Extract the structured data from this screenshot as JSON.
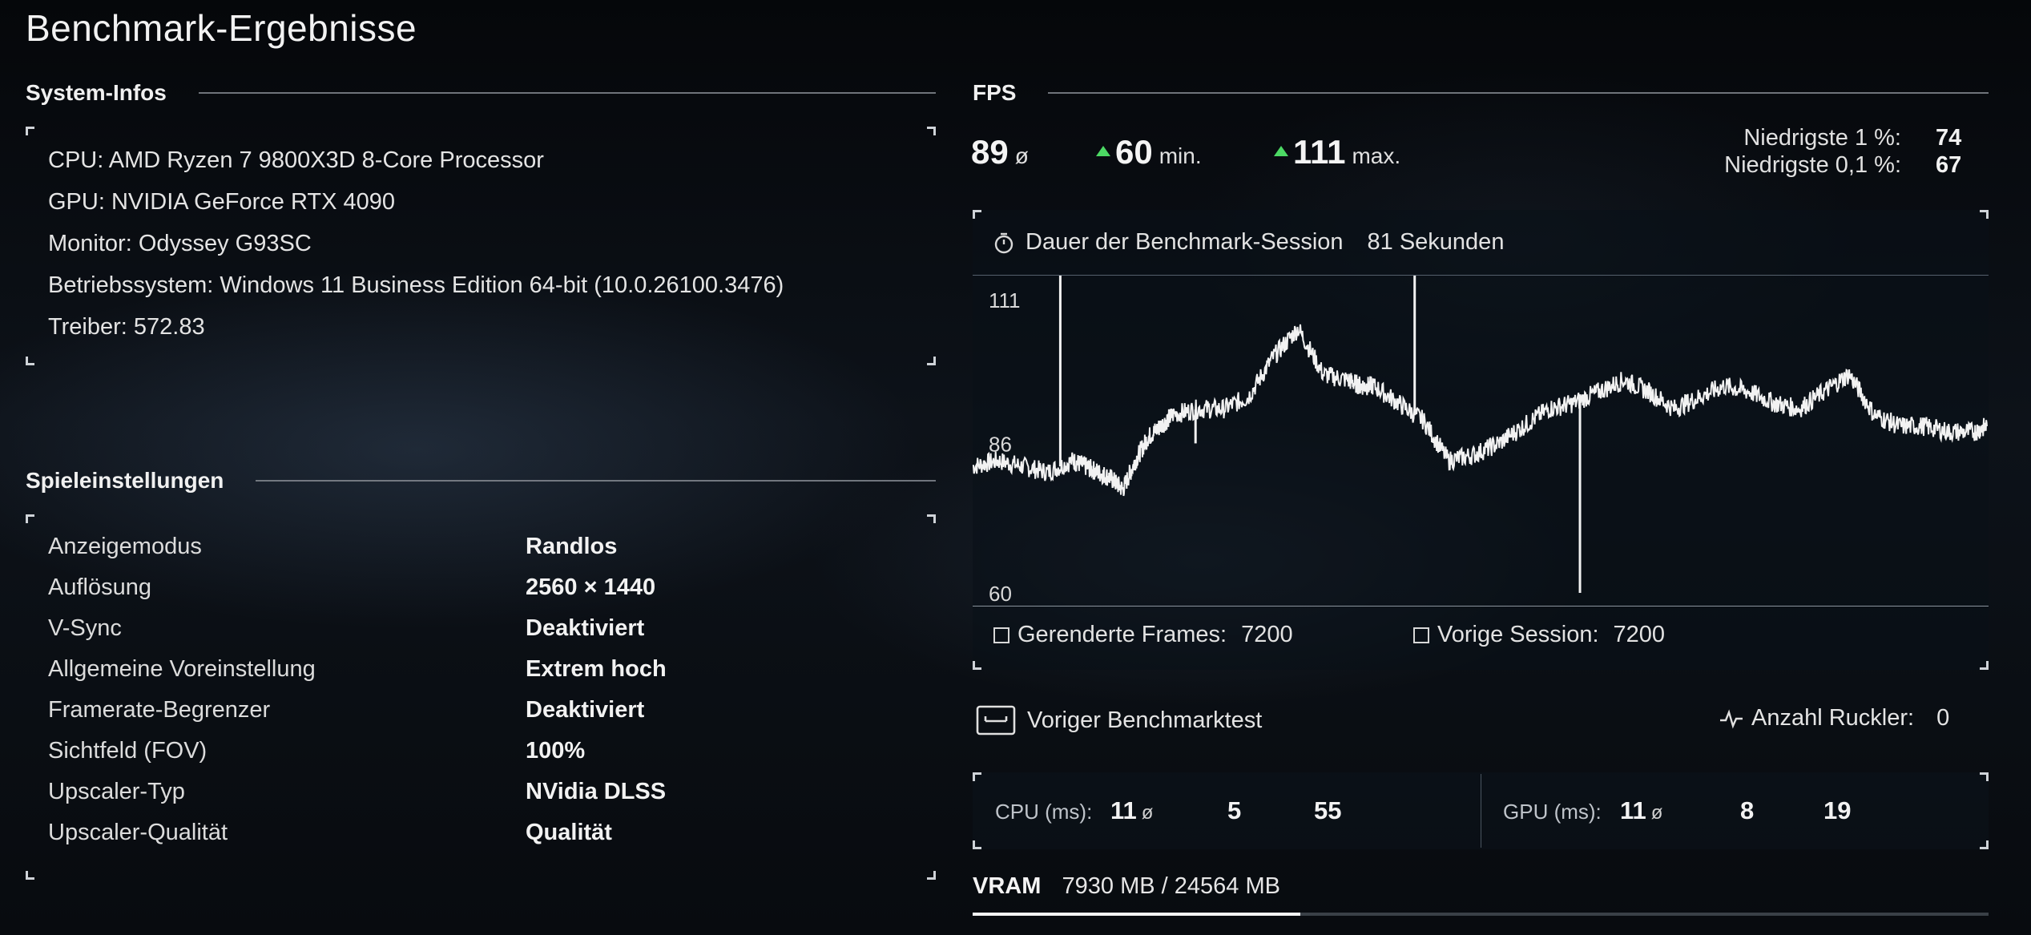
{
  "title": "Benchmark-Ergebnisse",
  "system_info": {
    "heading": "System-Infos",
    "lines": [
      "CPU: AMD Ryzen 7 9800X3D 8-Core Processor",
      "GPU: NVIDIA GeForce RTX 4090",
      "Monitor: Odyssey G93SC",
      "Betriebssystem: Windows 11 Business Edition 64-bit (10.0.26100.3476)",
      "Treiber: 572.83"
    ]
  },
  "game_settings": {
    "heading": "Spieleinstellungen",
    "rows": [
      {
        "label": "Anzeigemodus",
        "value": "Randlos"
      },
      {
        "label": "Auflösung",
        "value": "2560 × 1440"
      },
      {
        "label": "V-Sync",
        "value": "Deaktiviert"
      },
      {
        "label": "Allgemeine Voreinstellung",
        "value": "Extrem hoch"
      },
      {
        "label": "Framerate-Begrenzer",
        "value": "Deaktiviert"
      },
      {
        "label": "Sichtfeld (FOV)",
        "value": "100%"
      },
      {
        "label": "Upscaler-Typ",
        "value": "NVidia DLSS"
      },
      {
        "label": "Upscaler-Qualität",
        "value": "Qualität"
      }
    ]
  },
  "fps": {
    "heading": "FPS",
    "avg": "89",
    "avg_unit": "ø",
    "min": "60",
    "min_unit": "min.",
    "max": "111",
    "max_unit": "max.",
    "low1_label": "Niedrigste 1 %:",
    "low1_value": "74",
    "low01_label": "Niedrigste 0,1 %:",
    "low01_value": "67",
    "indicator_color": "#4cd964"
  },
  "session": {
    "icon": "stopwatch-icon",
    "label": "Dauer der Benchmark-Session",
    "value": "81 Sekunden"
  },
  "chart_data": {
    "type": "line",
    "title": "",
    "xlabel": "",
    "ylabel": "",
    "ylim": [
      60,
      111
    ],
    "yticks": [
      "111",
      "86",
      "60"
    ],
    "x": [
      0,
      2,
      4,
      6,
      8,
      9,
      10,
      11,
      12,
      13,
      14,
      15,
      16,
      18,
      20,
      22,
      24,
      26,
      28,
      30,
      31,
      32,
      34,
      36,
      38,
      40,
      42,
      44,
      46,
      48,
      50,
      52,
      54,
      56,
      58,
      60,
      62,
      64,
      66,
      68,
      70,
      72,
      74,
      76,
      78,
      80,
      81
    ],
    "series": [
      {
        "values": [
          82,
          83,
          82,
          81,
          83,
          82,
          81,
          80,
          78,
          83,
          87,
          89,
          91,
          92,
          92,
          94,
          101,
          106,
          98,
          97,
          96,
          96,
          93,
          90,
          83,
          84,
          86,
          89,
          92,
          93,
          95,
          97,
          95,
          92,
          94,
          96,
          95,
          93,
          92,
          95,
          98,
          91,
          89,
          89,
          88,
          88,
          89
        ]
      }
    ],
    "spikes": [
      {
        "x": 7,
        "y": 111
      },
      {
        "x": 35.3,
        "y": 111
      },
      {
        "x": 48.5,
        "y": 60
      },
      {
        "x": 17.8,
        "y": 86
      }
    ]
  },
  "legend": {
    "rendered_label": "Gerenderte Frames:",
    "rendered_value": "7200",
    "previous_label": "Vorige Session:",
    "previous_value": "7200"
  },
  "previous_test": {
    "icon": "monitor-icon",
    "label": "Voriger Benchmarktest"
  },
  "stutter": {
    "icon": "pulse-icon",
    "label": "Anzahl Ruckler:",
    "value": "0"
  },
  "cpu_ms": {
    "label": "CPU (ms):",
    "avg": "11",
    "unit": "ø",
    "min": "5",
    "max": "55"
  },
  "gpu_ms": {
    "label": "GPU (ms):",
    "avg": "11",
    "unit": "ø",
    "min": "8",
    "max": "19"
  },
  "vram": {
    "label": "VRAM",
    "value": "7930 MB / 24564 MB",
    "used_fraction": 0.3228
  }
}
